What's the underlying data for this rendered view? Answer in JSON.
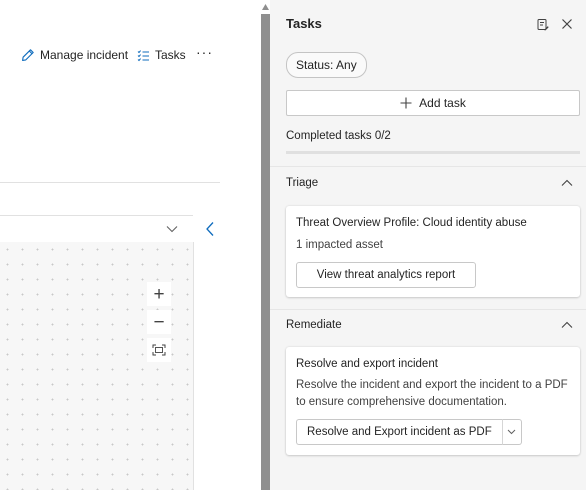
{
  "toolbar": {
    "manage_incident_label": "Manage incident",
    "tasks_label": "Tasks",
    "more_label": "···"
  },
  "graph_controls": {
    "zoom_in": "+",
    "zoom_out": "−"
  },
  "panel": {
    "title": "Tasks",
    "status_filter": "Status: Any",
    "add_task_label": "Add task",
    "completed_text": "Completed tasks 0/2",
    "progress_fraction": 0
  },
  "sections": [
    {
      "title": "Triage",
      "card": {
        "title": "Threat Overview Profile: Cloud identity abuse",
        "text": "1 impacted asset",
        "button_label": "View threat analytics report"
      }
    },
    {
      "title": "Remediate",
      "card": {
        "title": "Resolve and export incident",
        "text": "Resolve the incident and export the incident to a PDF to ensure comprehensive documentation.",
        "button_label": "Resolve and Export incident as PDF"
      }
    }
  ],
  "colors": {
    "accent": "#0f6cbd",
    "panel_bg": "#f5f5f5",
    "scrollbar": "#8f8f8f"
  },
  "icons": [
    "pencil-icon",
    "task-list-icon",
    "more-icon",
    "chevron-down-icon",
    "chevron-left-icon",
    "zoom-in-icon",
    "zoom-out-icon",
    "fit-screen-icon",
    "panel-options-icon",
    "close-icon",
    "plus-icon",
    "chevron-up-icon"
  ]
}
